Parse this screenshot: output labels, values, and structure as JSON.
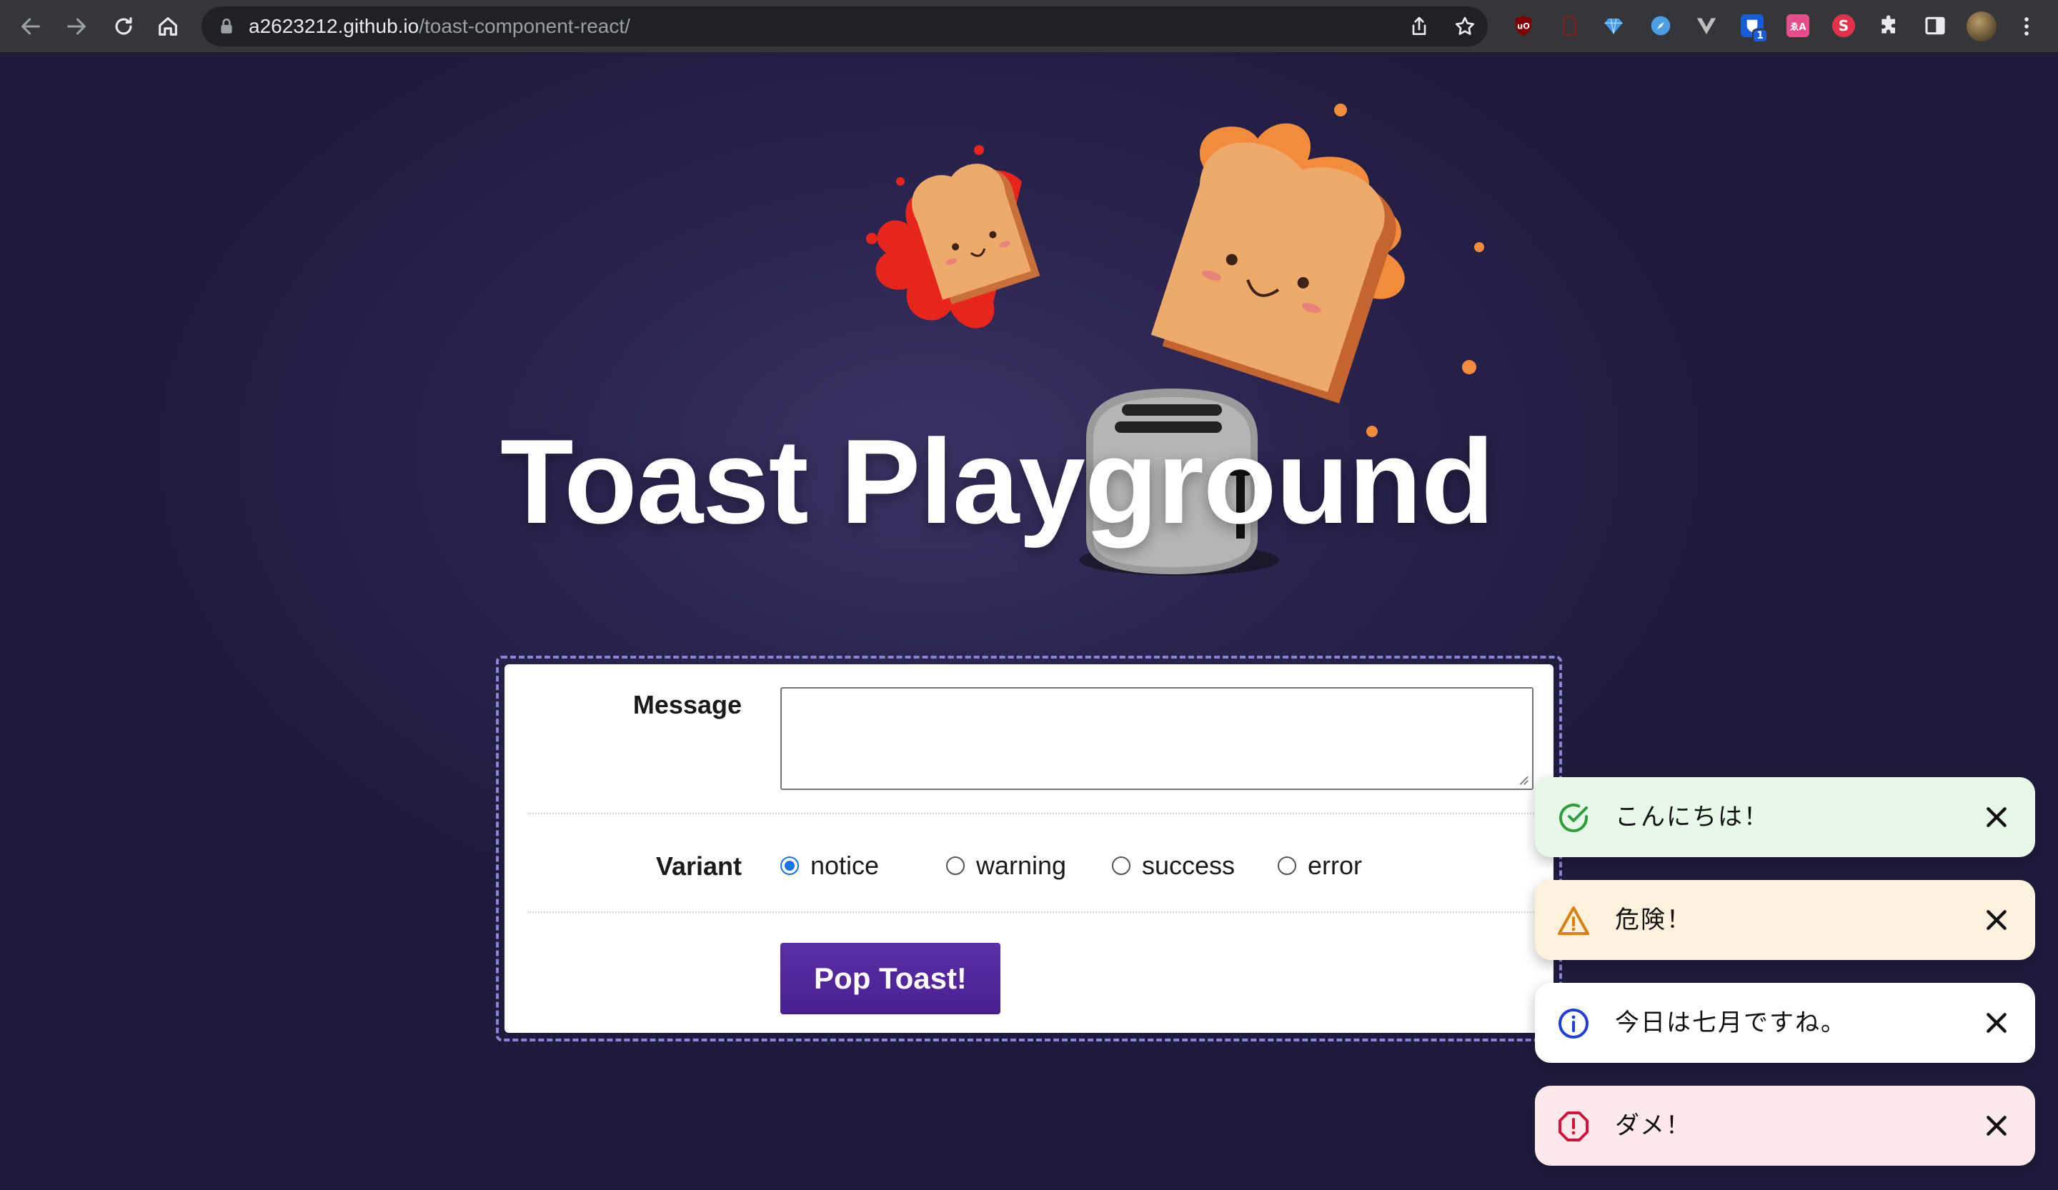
{
  "browser": {
    "url_host": "a2623212.github.io",
    "url_path": "/toast-component-react/",
    "nav_icons": [
      "back-icon",
      "forward-icon",
      "reload-icon",
      "home-icon"
    ],
    "extensions": [
      {
        "name": "ublock-origin-icon",
        "text": "uO",
        "color": "#a10000"
      },
      {
        "name": "pdf-extension-icon",
        "text": "",
        "color": "#6b1f1f"
      },
      {
        "name": "diamond-extension-icon",
        "text": "",
        "color": "#3d9cf0"
      },
      {
        "name": "compass-extension-icon",
        "text": "",
        "color": "#4a9ee6"
      },
      {
        "name": "vue-devtools-icon",
        "text": "",
        "color": "#bdbdbd"
      },
      {
        "name": "bitwarden-icon",
        "text": "1",
        "color": "#175ddc"
      },
      {
        "name": "translate-extension-icon",
        "text": "ゑA",
        "color": "#e84b8a"
      },
      {
        "name": "s-extension-icon",
        "text": "S",
        "color": "#e5304a"
      },
      {
        "name": "extensions-puzzle-icon",
        "text": "",
        "color": "#e8eaed"
      },
      {
        "name": "side-panel-icon",
        "text": "",
        "color": "#e8eaed"
      }
    ]
  },
  "page": {
    "title": "Toast Playground"
  },
  "form": {
    "message_label": "Message",
    "message_value": "",
    "variant_label": "Variant",
    "variants": [
      {
        "label": "notice",
        "checked": true
      },
      {
        "label": "warning",
        "checked": false
      },
      {
        "label": "success",
        "checked": false
      },
      {
        "label": "error",
        "checked": false
      }
    ],
    "submit_label": "Pop Toast!"
  },
  "toasts": [
    {
      "variant": "success",
      "icon": "check-circle-icon",
      "text": "こんにちは！",
      "bg": "#e6f9e8",
      "accent": "#2e9e3a"
    },
    {
      "variant": "warning",
      "icon": "warning-triangle-icon",
      "text": "危険！",
      "bg": "#fdf1dc",
      "accent": "#d9820f"
    },
    {
      "variant": "notice",
      "icon": "info-circle-icon",
      "text": "今日は七月ですね。",
      "bg": "#ffffff",
      "accent": "#1f3fd6"
    },
    {
      "variant": "error",
      "icon": "alert-octagon-icon",
      "text": "ダメ！",
      "bg": "#fde8ea",
      "accent": "#d3123a"
    }
  ]
}
